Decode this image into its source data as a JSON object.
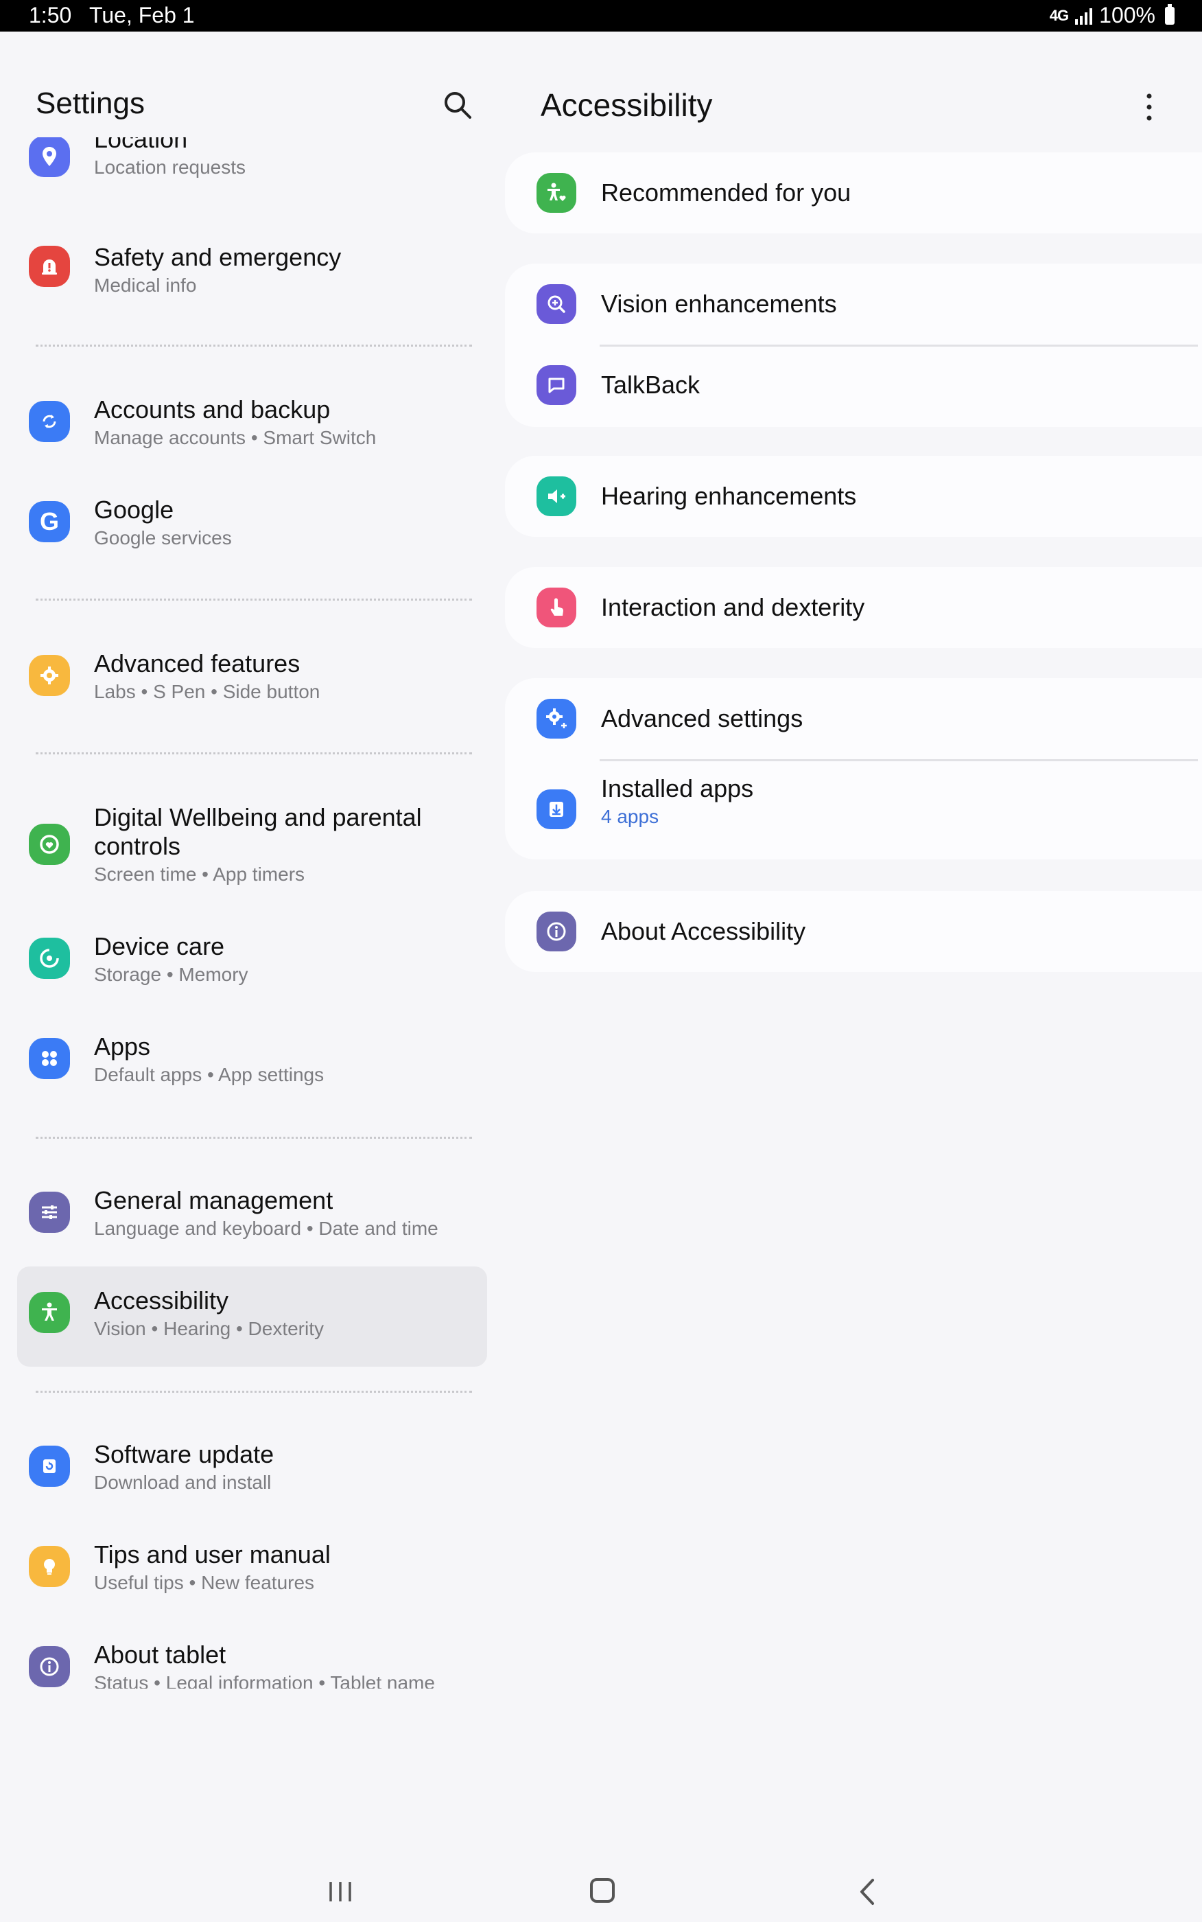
{
  "status_bar": {
    "time": "1:50",
    "date": "Tue, Feb 1",
    "network": "4G",
    "battery": "100%"
  },
  "left_pane": {
    "title": "Settings",
    "search_icon": "search-icon",
    "items": [
      {
        "title": "Location",
        "subtitle": "Location requests",
        "icon": "location-pin-icon",
        "color": "#5b6ff0"
      },
      {
        "title": "Safety and emergency",
        "subtitle": "Medical info",
        "icon": "emergency-icon",
        "color": "#e5453f"
      },
      {
        "title": "Accounts and backup",
        "subtitle": "Manage accounts  •  Smart Switch",
        "icon": "sync-icon",
        "color": "#3b7bf5"
      },
      {
        "title": "Google",
        "subtitle": "Google services",
        "icon": "google-icon",
        "color": "#3b7bf5"
      },
      {
        "title": "Advanced features",
        "subtitle": "Labs  •  S Pen  •  Side button",
        "icon": "gear-plus-icon",
        "color": "#f8b83e"
      },
      {
        "title": "Digital Wellbeing and parental",
        "title2": "controls",
        "subtitle": "Screen time  •  App timers",
        "icon": "wellbeing-icon",
        "color": "#3fb34f"
      },
      {
        "title": "Device care",
        "subtitle": "Storage  •  Memory",
        "icon": "device-care-icon",
        "color": "#1ebf9f"
      },
      {
        "title": "Apps",
        "subtitle": "Default apps  •  App settings",
        "icon": "apps-grid-icon",
        "color": "#3b7bf5"
      },
      {
        "title": "General management",
        "subtitle": "Language and keyboard  •  Date and time",
        "icon": "sliders-icon",
        "color": "#6c67ae"
      },
      {
        "title": "Accessibility",
        "subtitle": "Vision  •  Hearing  •  Dexterity",
        "icon": "accessibility-icon",
        "color": "#3fb34f",
        "selected": true
      },
      {
        "title": "Software update",
        "subtitle": "Download and install",
        "icon": "software-update-icon",
        "color": "#3b7bf5"
      },
      {
        "title": "Tips and user manual",
        "subtitle": "Useful tips  •  New features",
        "icon": "lightbulb-icon",
        "color": "#f8b83e"
      },
      {
        "title": "About tablet",
        "subtitle": "Status  •  Legal information  •  Tablet name",
        "icon": "info-icon",
        "color": "#6c67ae"
      }
    ]
  },
  "right_pane": {
    "title": "Accessibility",
    "more_icon": "more-vert-icon",
    "rows": [
      {
        "title": "Recommended for you",
        "icon": "accessibility-heart-icon",
        "color": "#3fb34f"
      },
      {
        "title": "Vision enhancements",
        "icon": "zoom-in-icon",
        "color": "#6a5ad8"
      },
      {
        "title": "TalkBack",
        "icon": "talkback-icon",
        "color": "#6a5ad8"
      },
      {
        "title": "Hearing enhancements",
        "icon": "hearing-icon",
        "color": "#1ebf9f"
      },
      {
        "title": "Interaction and dexterity",
        "icon": "touch-icon",
        "color": "#f0557a"
      },
      {
        "title": "Advanced settings",
        "icon": "gear-plus-icon",
        "color": "#3b7bf5"
      },
      {
        "title": "Installed apps",
        "subtitle": "4 apps",
        "icon": "download-icon",
        "color": "#3b7bf5"
      },
      {
        "title": "About Accessibility",
        "icon": "info-icon",
        "color": "#6c67ae"
      }
    ]
  },
  "nav_bar": {
    "recents_icon": "recents-icon",
    "home_icon": "home-icon",
    "back_icon": "back-icon"
  }
}
